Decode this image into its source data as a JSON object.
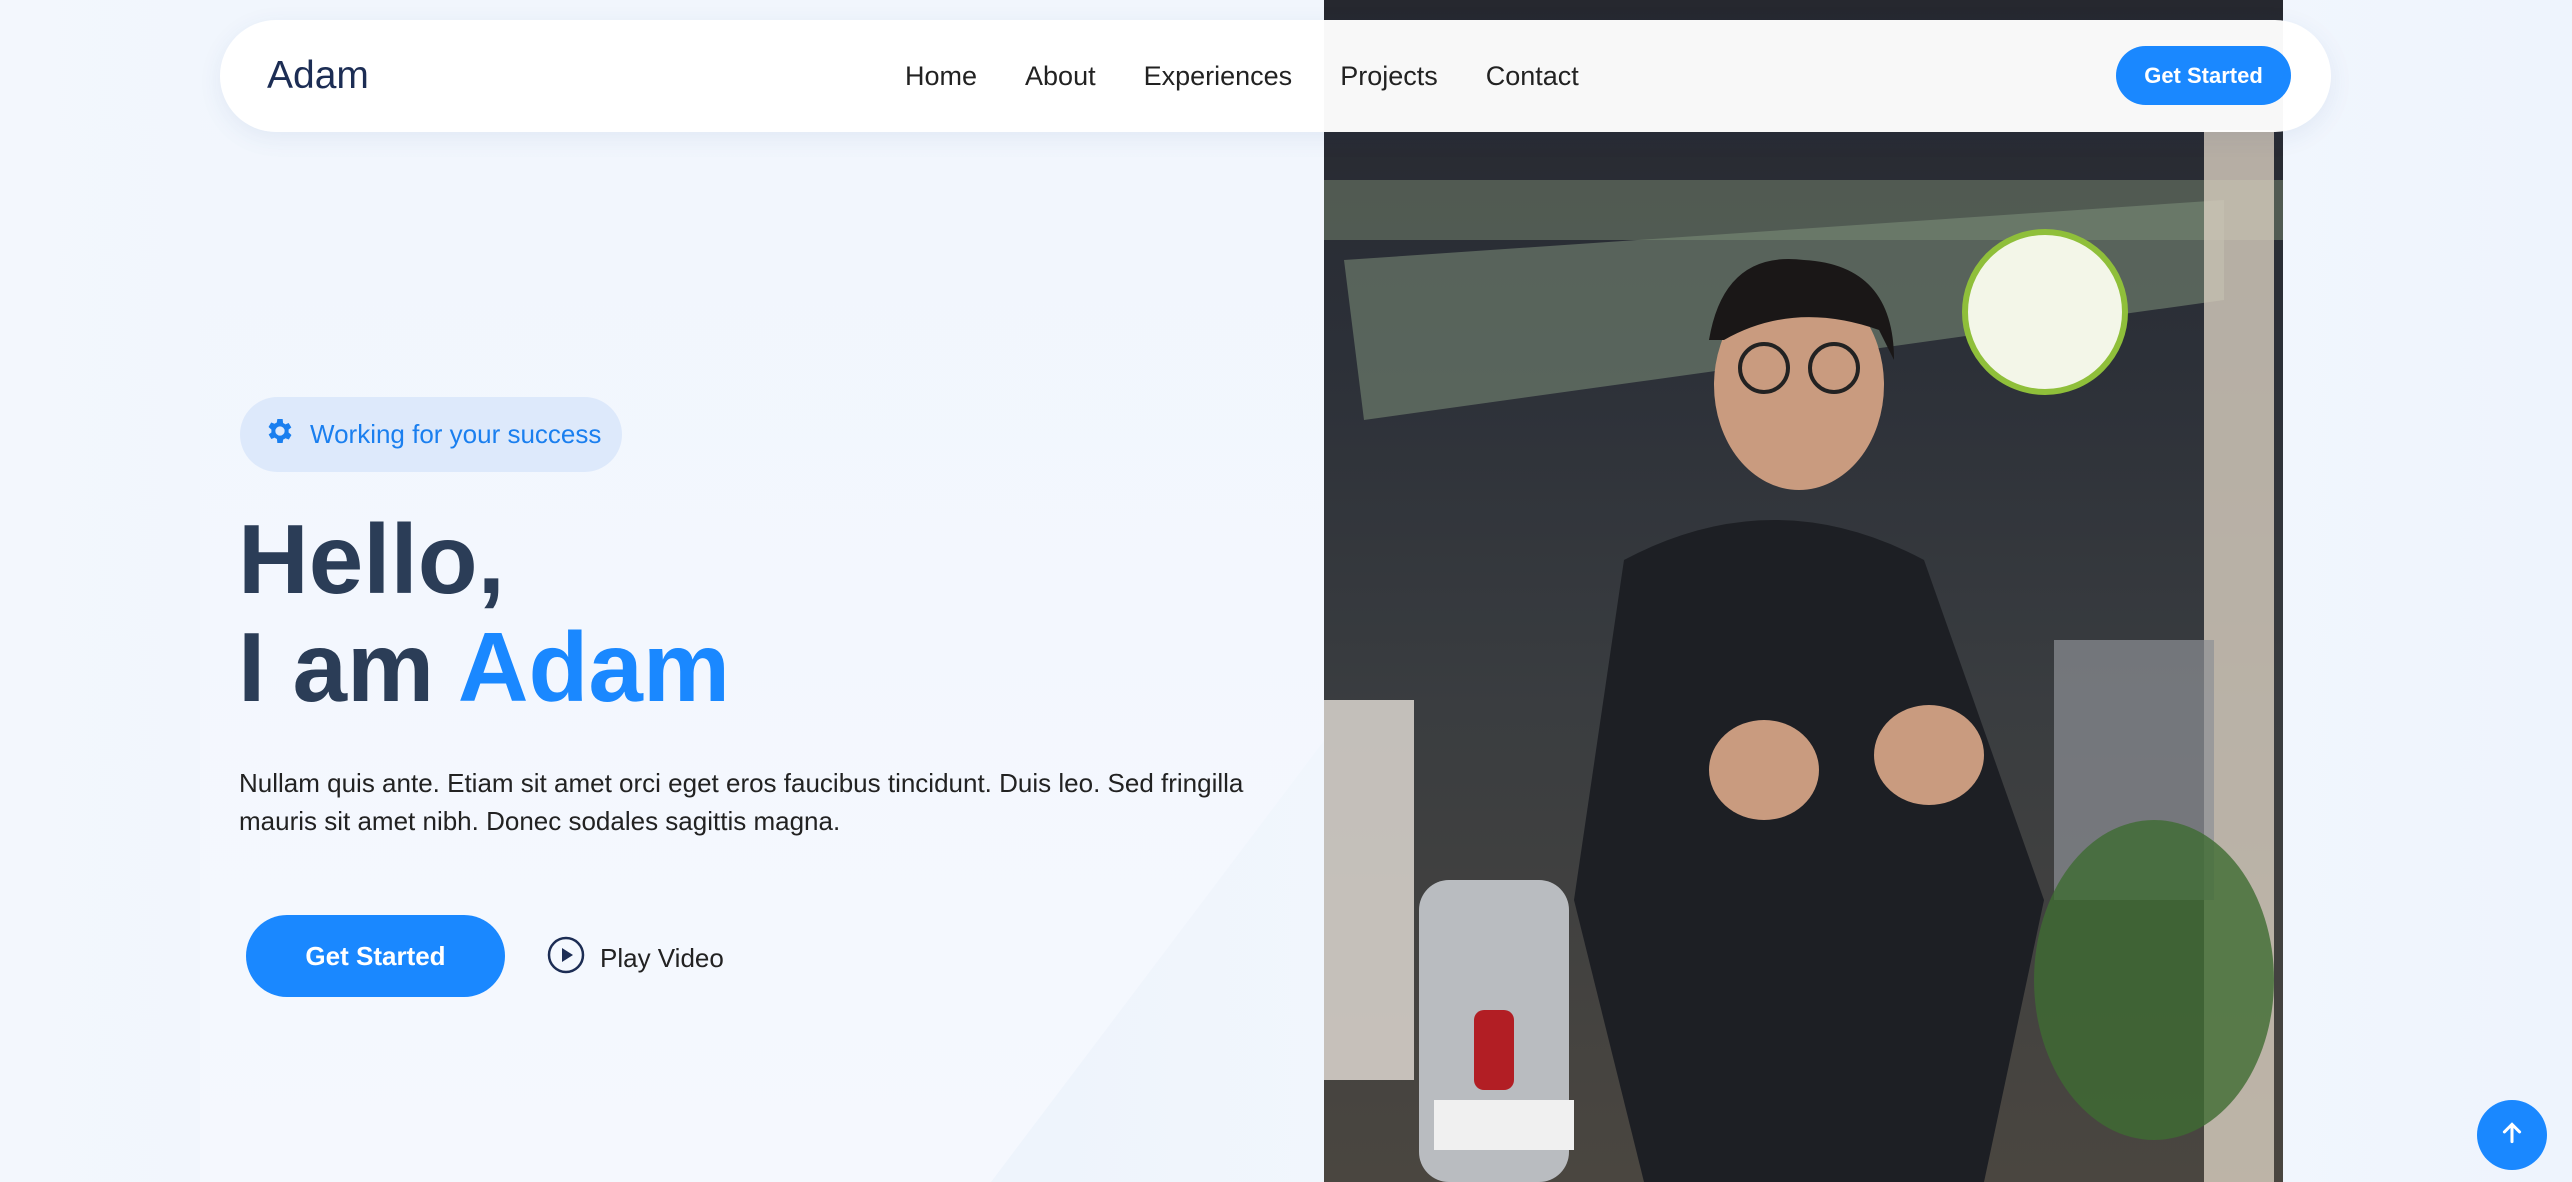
{
  "nav": {
    "logo": "Adam",
    "links": [
      "Home",
      "About",
      "Experiences",
      "Projects",
      "Contact"
    ],
    "cta": "Get Started"
  },
  "hero": {
    "badge": "Working for your success",
    "badge_icon": "gear-icon",
    "title_line1": "Hello,",
    "title_line2_prefix": "I am ",
    "title_line2_name": "Adam",
    "description": "Nullam quis ante. Etiam sit amet orci eget eros faucibus tincidunt. Duis leo. Sed fringilla mauris sit amet nibh. Donec sodales sagittis magna.",
    "cta": "Get Started",
    "play_label": "Play Video"
  },
  "colors": {
    "accent": "#1a88ff",
    "heading": "#2b3d57",
    "badge_bg": "#dde9fb"
  }
}
